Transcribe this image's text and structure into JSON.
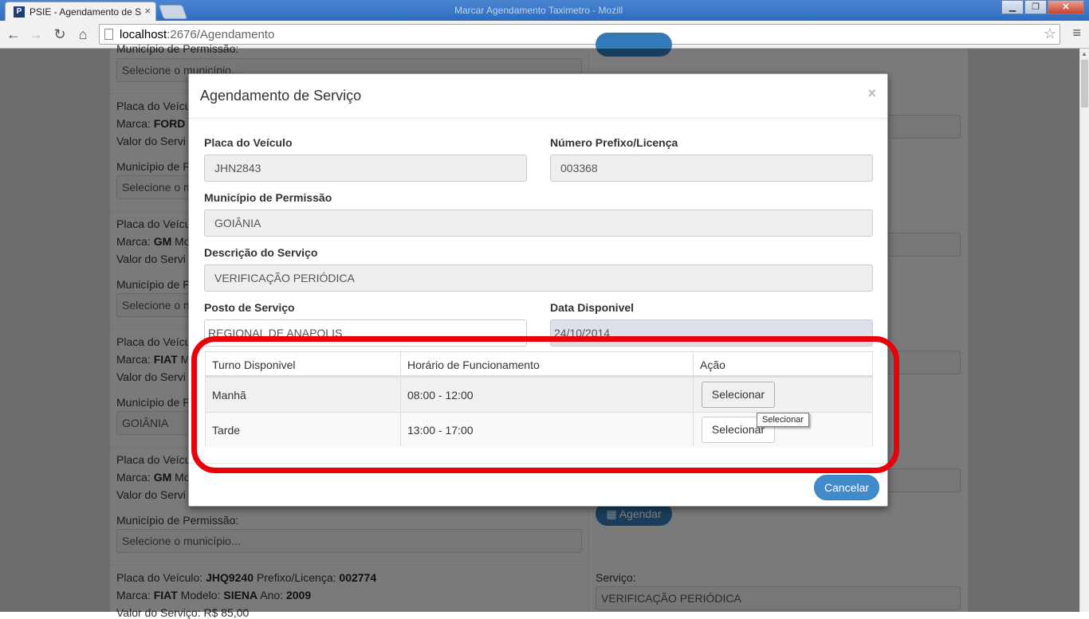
{
  "browser": {
    "tab_title": "PSIE - Agendamento de Se",
    "tab_close": "×",
    "window_title": "Marcar Agendamento Taximetro - Mozill",
    "url_host": "localhost",
    "url_path": ":2676/Agendamento",
    "favicon_letter": "P"
  },
  "background": {
    "rows": [
      {
        "label_municipio": "Município de Permissão:",
        "select_value": "Selecione o município..."
      },
      {
        "placa_prefix": "Placa do Veícu",
        "marca_label": "Marca: ",
        "marca": "FORD",
        "valor": "Valor do Servi",
        "municipio_cut": "Município de P",
        "select_cut": "Selecione o m"
      },
      {
        "placa_prefix": "Placa do Veícu",
        "marca_label": "Marca: ",
        "marca": "GM",
        "modelo_cut": " Mo",
        "valor": "Valor do Servi",
        "municipio_cut": "Município de F",
        "select_cut": "Selecione o m"
      },
      {
        "placa_prefix": "Placa do Veícu",
        "marca_label": "Marca: ",
        "marca": "FIAT",
        "modelo_cut": " M",
        "valor": "Valor do Servi",
        "municipio_cut": "Município de P",
        "select_cut": "GOIÂNIA"
      },
      {
        "placa_prefix": "Placa do Veícu",
        "marca_label": "Marca: ",
        "marca": "GM",
        "modelo_cut": " Mo",
        "valor": "Valor do Servi",
        "municipio_label": "Município de Permissão:",
        "select_value": "Selecione o município..."
      },
      {
        "placa_label": "Placa do Veículo: ",
        "placa": "JHQ9240",
        "prefixo_label": " Prefixo/Licença: ",
        "prefixo": "002774",
        "marca_label": "Marca: ",
        "marca": "FIAT",
        "modelo_label": " Modelo: ",
        "modelo": "SIENA",
        "ano_label": " Ano: ",
        "ano": "2009",
        "valor_cut": "Valor do Serviço: R$ 85,00"
      }
    ],
    "right_col": {
      "agendar_label": "Agendar",
      "servico_label": "Serviço:",
      "servico_value": "VERIFICAÇÃO PERIÓDICA"
    }
  },
  "modal": {
    "title": "Agendamento de Serviço",
    "close": "×",
    "fields": {
      "placa_label": "Placa do Veículo",
      "placa_value": "JHN2843",
      "prefixo_label": "Número Prefixo/Licença",
      "prefixo_value": "003368",
      "municipio_label": "Município de Permissão",
      "municipio_value": "GOIÂNIA",
      "descricao_label": "Descrição do Serviço",
      "descricao_value": "VERIFICAÇÃO PERIÓDICA",
      "posto_label": "Posto de Serviço",
      "posto_value": "REGIONAL DE ANAPOLIS",
      "data_label": "Data Disponivel",
      "data_value": "24/10/2014"
    },
    "table": {
      "headers": [
        "Turno Disponivel",
        "Horário de Funcionamento",
        "Ação"
      ],
      "rows": [
        {
          "turno": "Manhã",
          "horario": "08:00 - 12:00",
          "acao": "Selecionar"
        },
        {
          "turno": "Tarde",
          "horario": "13:00 - 17:00",
          "acao": "Selecionar"
        }
      ]
    },
    "tooltip": "Selecionar",
    "cancel_label": "Cancelar"
  },
  "colors": {
    "primary": "#428bca",
    "highlight": "#e8000b"
  }
}
